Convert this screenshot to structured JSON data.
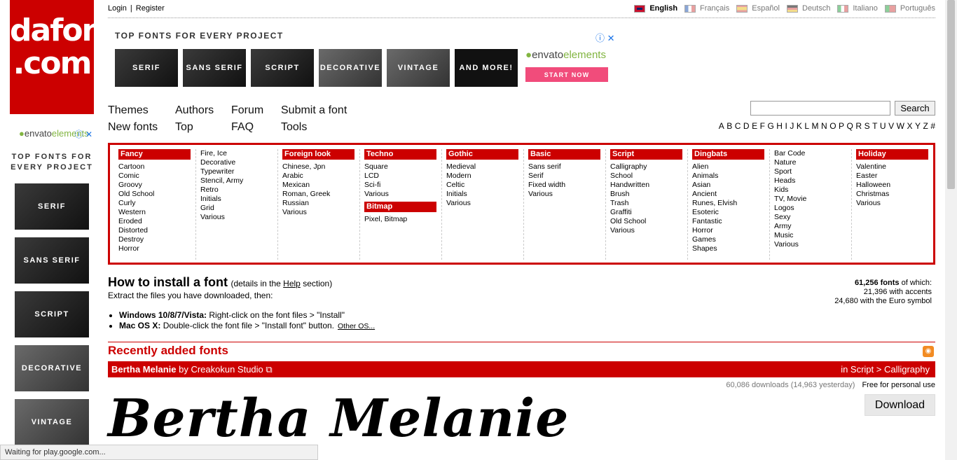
{
  "logo": {
    "line1": "dafont",
    "line2": ".com"
  },
  "top": {
    "login": "Login",
    "separator": "|",
    "register": "Register",
    "languages": [
      "English",
      "Français",
      "Español",
      "Deutsch",
      "Italiano",
      "Português"
    ]
  },
  "ad_top": {
    "title": "TOP FONTS FOR EVERY PROJECT",
    "tiles": [
      "SERIF",
      "SANS SERIF",
      "SCRIPT",
      "DECORATIVE",
      "VINTAGE",
      "AND MORE!"
    ],
    "brand": "envato",
    "brand_suffix": "elements",
    "cta": "START NOW",
    "icons": "ⓘ ✕"
  },
  "nav": {
    "themes": "Themes",
    "new_fonts": "New fonts",
    "authors": "Authors",
    "top": "Top",
    "forum": "Forum",
    "faq": "FAQ",
    "submit": "Submit a font",
    "tools": "Tools"
  },
  "search": {
    "button": "Search",
    "value": ""
  },
  "alphabet": [
    "A",
    "B",
    "C",
    "D",
    "E",
    "F",
    "G",
    "H",
    "I",
    "J",
    "K",
    "L",
    "M",
    "N",
    "O",
    "P",
    "Q",
    "R",
    "S",
    "T",
    "U",
    "V",
    "W",
    "X",
    "Y",
    "Z",
    "#"
  ],
  "categories": [
    {
      "head": "Fancy",
      "items": [
        "Cartoon",
        "Comic",
        "Groovy",
        "Old School",
        "Curly",
        "Western",
        "Eroded",
        "Distorted",
        "Destroy",
        "Horror"
      ]
    },
    {
      "head": "",
      "items": [
        "Fire, Ice",
        "Decorative",
        "Typewriter",
        "Stencil, Army",
        "Retro",
        "Initials",
        "Grid",
        "Various"
      ]
    },
    {
      "head": "Foreign look",
      "items": [
        "Chinese, Jpn",
        "Arabic",
        "Mexican",
        "Roman, Greek",
        "Russian",
        "Various"
      ]
    },
    {
      "head": "Techno",
      "items": [
        "Square",
        "LCD",
        "Sci-fi",
        "Various"
      ],
      "sub_head": "Bitmap",
      "sub_items": [
        "Pixel, Bitmap"
      ]
    },
    {
      "head": "Gothic",
      "items": [
        "Medieval",
        "Modern",
        "Celtic",
        "Initials",
        "Various"
      ]
    },
    {
      "head": "Basic",
      "items": [
        "Sans serif",
        "Serif",
        "Fixed width",
        "Various"
      ]
    },
    {
      "head": "Script",
      "items": [
        "Calligraphy",
        "School",
        "Handwritten",
        "Brush",
        "Trash",
        "Graffiti",
        "Old School",
        "Various"
      ]
    },
    {
      "head": "Dingbats",
      "items": [
        "Alien",
        "Animals",
        "Asian",
        "Ancient",
        "Runes, Elvish",
        "Esoteric",
        "Fantastic",
        "Horror",
        "Games",
        "Shapes"
      ]
    },
    {
      "head": "",
      "items": [
        "Bar Code",
        "Nature",
        "Sport",
        "Heads",
        "Kids",
        "TV, Movie",
        "Logos",
        "Sexy",
        "Army",
        "Music",
        "Various"
      ]
    },
    {
      "head": "Holiday",
      "items": [
        "Valentine",
        "Easter",
        "Halloween",
        "Christmas",
        "Various"
      ]
    }
  ],
  "install": {
    "title": "How to install a font",
    "details_pre": "(details in the ",
    "details_link": "Help",
    "details_post": " section)",
    "extract": "Extract the files you have downloaded, then:",
    "win_label": "Windows 10/8/7/Vista:",
    "win_text": " Right-click on the font files > \"Install\"",
    "mac_label": "Mac OS X:",
    "mac_text": " Double-click the font file > \"Install font\" button.",
    "other": "Other OS..."
  },
  "stats": {
    "count": "61,256 fonts",
    "of_which": " of which:",
    "accents": "21,396 with accents",
    "euro": "24,680 with the Euro symbol"
  },
  "recent": {
    "title": "Recently added fonts",
    "font_name": "Bertha Melanie",
    "by": " by Creakokun Studio",
    "ext_icon": "⧉",
    "category": "in Script > Calligraphy",
    "downloads": "60,086 downloads (14,963 yesterday)",
    "license": "Free for personal use",
    "download": "Download",
    "preview": "Bertha Melanie"
  },
  "ad_left": {
    "brand": "envato",
    "brand_suffix": "elements",
    "icons": "ⓘ ✕",
    "title": "TOP FONTS FOR EVERY PROJECT",
    "tiles": [
      "SERIF",
      "SANS SERIF",
      "SCRIPT",
      "DECORATIVE",
      "VINTAGE"
    ]
  },
  "status": "Waiting for play.google.com..."
}
